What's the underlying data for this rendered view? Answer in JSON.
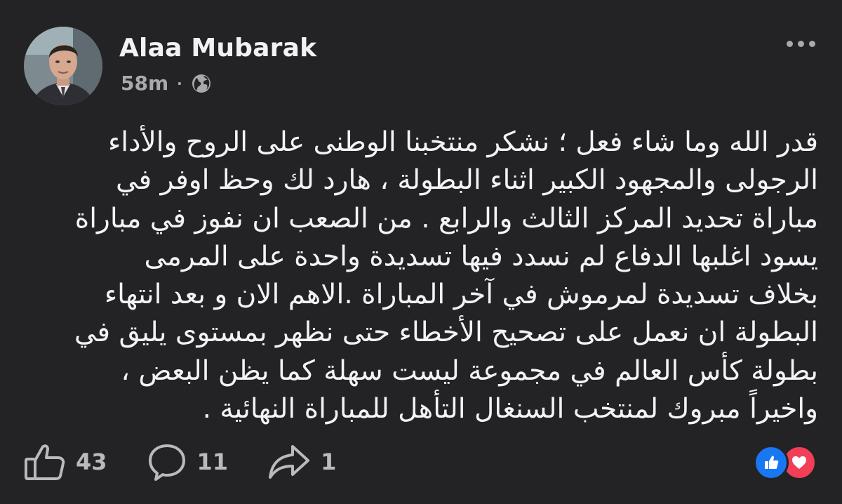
{
  "post": {
    "author": "Alaa Mubarak",
    "time": "58m",
    "separator": "·",
    "privacy_icon": "globe-icon",
    "menu_icon": "more-horizontal-icon",
    "text_lines": [
      "قدر الله وما شاء فعل ؛ نشكر منتخبنا الوطنى على الروح والأداء",
      "الرجولى والمجهود الكبير اثناء البطولة ، هارد لك وحظ اوفر في",
      "مباراة تحديد المركز الثالث والرابع . من الصعب ان نفوز في مباراة",
      "يسود اغلبها الدفاع لم نسدد فيها تسديدة واحدة على المرمى",
      "بخلاف تسديدة لمرموش في آخر المباراة .الاهم الان و بعد انتهاء",
      "البطولة ان نعمل على تصحيح الأخطاء حتى نظهر بمستوى يليق في",
      "بطولة كأس العالم في مجموعة ليست سهلة كما يظن البعض ،",
      "واخيراً مبروك لمنتخب السنغال التأهل للمباراة النهائية ."
    ]
  },
  "footer": {
    "likes": "43",
    "comments": "11",
    "shares": "1",
    "reactions": [
      "like",
      "love"
    ]
  },
  "colors": {
    "background": "#232325",
    "text": "#f3f3f5",
    "muted": "#a8a8ad",
    "like_blue": "#1877f2",
    "love_red": "#f33e58"
  }
}
